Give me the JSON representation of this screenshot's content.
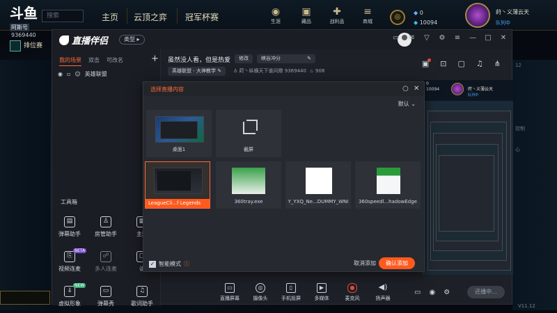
{
  "game_client": {
    "logo": "斗鱼",
    "logo_sub": "阿斯号",
    "uid": "9369440",
    "search_placeholder": "搜索",
    "nav": [
      "主页",
      "云顶之弈",
      "冠军杯赛"
    ],
    "top_icons": [
      {
        "icon": "user-icon",
        "label": "生涯"
      },
      {
        "icon": "collection-icon",
        "label": "藏品"
      },
      {
        "icon": "loot-icon",
        "label": "战利品"
      },
      {
        "icon": "store-icon",
        "label": "商城"
      }
    ],
    "currency": {
      "blue_essence": "0",
      "riot_points": "10094"
    },
    "player": {
      "name": "莳丶义薄云天",
      "status": "队列中"
    },
    "rank_label": "排位赛",
    "side_text": [
      "12",
      "控制",
      "心"
    ],
    "version": "V11.12"
  },
  "app": {
    "name": "直播伴侣",
    "mode": "类型",
    "scenes": {
      "tabs": [
        "我的场景",
        "双击",
        "可改名"
      ],
      "add": "+",
      "scene_name": "英雄联盟"
    },
    "stream": {
      "title": "虽然没人看，但是热爱",
      "edit_label": "修改",
      "tag": "峡谷冲分",
      "category": "英雄联盟 - 大神教学",
      "streamer": "莳丶纵横天下谁问鼎",
      "room_id": "9369440",
      "heat": "908"
    },
    "tools_title": "工具箱",
    "tools": [
      {
        "label": "弹幕助手",
        "icon": "danmu-icon"
      },
      {
        "label": "房管助手",
        "icon": "admin-icon"
      },
      {
        "label": "主题",
        "icon": "theme-icon"
      },
      {
        "label": "视频连麦",
        "icon": "video-link-icon",
        "badge": "BETA"
      },
      {
        "label": "多人连麦",
        "icon": "multi-link-icon"
      },
      {
        "label": "读",
        "icon": "read-icon"
      },
      {
        "label": "虚拟形象",
        "icon": "avatar-icon",
        "badge": "NEW"
      },
      {
        "label": "弹幕秀",
        "icon": "danmu-show-icon"
      },
      {
        "label": "歌词助手",
        "icon": "lyrics-icon"
      },
      {
        "label": "",
        "icon": "game-icon",
        "badge": "HOT"
      },
      {
        "label": "",
        "icon": "download-icon"
      },
      {
        "label": "",
        "icon": "controller-icon"
      }
    ],
    "bottom_toolbar": [
      {
        "label": "直播屏幕",
        "icon": "screen-icon"
      },
      {
        "label": "摄像头",
        "icon": "camera-icon"
      },
      {
        "label": "手机投屏",
        "icon": "phone-icon"
      },
      {
        "label": "多媒体",
        "icon": "media-icon"
      },
      {
        "label": "麦克风",
        "icon": "mic-icon"
      },
      {
        "label": "扬声器",
        "icon": "speaker-icon"
      }
    ],
    "live_button": "还播中...",
    "preview": {
      "player_name": "莳丶义薄云天",
      "status": "队列中",
      "currency_a": "0",
      "currency_b": "10094"
    }
  },
  "dialog": {
    "title": "选择直播内容",
    "sort_label": "默认",
    "sources": [
      {
        "caption": "桌面1",
        "type": "desktop"
      },
      {
        "caption": "截屏",
        "type": "capture"
      },
      {
        "caption": "LeagueCli...f Legends",
        "type": "lol",
        "selected": true
      },
      {
        "caption": "360tray.exe",
        "type": "t360"
      },
      {
        "caption": "Y_YXQ_Ne...DUMMY_WNI",
        "type": "blank"
      },
      {
        "caption": "360speedl...hadowEdge",
        "type": "speed"
      }
    ],
    "smart_mode": "智能模式",
    "smart_checked": true,
    "cancel_label": "取消添加",
    "confirm_label": "确认添加",
    "accent": "#ff5a1e"
  }
}
